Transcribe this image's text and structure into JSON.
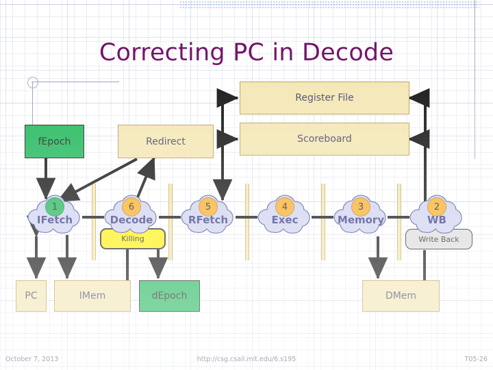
{
  "slide": {
    "title": "Correcting PC in Decode",
    "footer": {
      "date": "October 7, 2013",
      "url": "http://csg.csail.mit.edu/6.s195",
      "slide_id": "T05-26"
    }
  },
  "colors": {
    "title": "#66005c",
    "tan_fill": "#f3e4ae",
    "tan_border": "#b09a4a",
    "green_fill": "#11b24f",
    "yellow_fill": "#ffef00",
    "gray_fill": "#d9d9d9",
    "cloud_fill": "#ccd0ef",
    "cloud_border": "#3a3f86",
    "badge_orange": "#f7a81b",
    "badge_green": "#11b24f",
    "label_navy": "#2c2f7c",
    "wire": "#000000"
  },
  "boxes": [
    {
      "id": "fepoch",
      "label": "fEpoch",
      "style": "green"
    },
    {
      "id": "redirect",
      "label": "Redirect",
      "style": "tan"
    },
    {
      "id": "register_file",
      "label": "Register File",
      "style": "tan"
    },
    {
      "id": "scoreboard",
      "label": "Scoreboard",
      "style": "tan"
    },
    {
      "id": "killing",
      "label": "Killing",
      "style": "yellow"
    },
    {
      "id": "write_back",
      "label": "Write Back",
      "style": "gray"
    },
    {
      "id": "pc",
      "label": "PC",
      "style": "tan"
    },
    {
      "id": "imem",
      "label": "IMem",
      "style": "tan"
    },
    {
      "id": "depoch",
      "label": "dEpoch",
      "style": "green"
    },
    {
      "id": "dmem",
      "label": "DMem",
      "style": "tan"
    }
  ],
  "stages": [
    {
      "id": "ifetch",
      "label": "IFetch",
      "number": "1",
      "badge": "green"
    },
    {
      "id": "decode",
      "label": "Decode",
      "number": "6",
      "badge": "orange"
    },
    {
      "id": "rfetch",
      "label": "RFetch",
      "number": "5",
      "badge": "orange"
    },
    {
      "id": "exec",
      "label": "Exec",
      "number": "4",
      "badge": "orange"
    },
    {
      "id": "memory",
      "label": "Memory",
      "number": "3",
      "badge": "orange"
    },
    {
      "id": "wb",
      "label": "WB",
      "number": "2",
      "badge": "orange"
    }
  ]
}
